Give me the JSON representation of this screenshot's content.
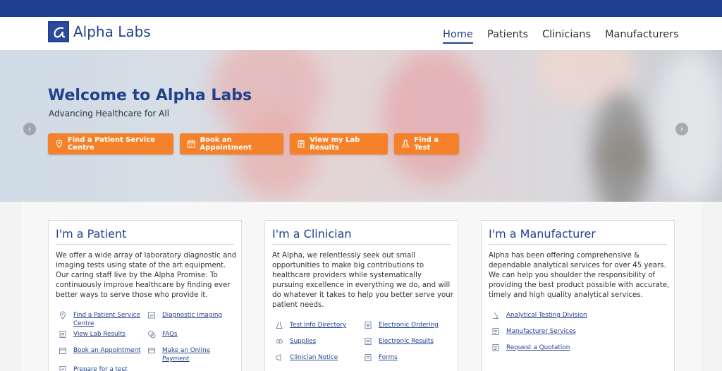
{
  "brand": {
    "name": "Alpha Labs"
  },
  "nav": {
    "home": "Home",
    "patients": "Patients",
    "clinicians": "Clinicians",
    "manufacturers": "Manufacturers"
  },
  "hero": {
    "title": "Welcome to Alpha Labs",
    "subtitle": "Advancing Healthcare for All",
    "buttons": [
      "Find a Patient Service Centre",
      "Book an Appointment",
      "View my Lab Results",
      "Find a Test"
    ]
  },
  "cards": {
    "patient": {
      "title": "I'm a Patient",
      "text": "We offer a wide array of laboratory diagnostic and imaging tests using state of the art equipment. Our caring staff live by the Alpha Promise: To continuously improve healthcare by finding ever better ways to serve those who provide it.",
      "links": [
        "Find a Patient Service Centre",
        "Diagnostic Imaging",
        "View Lab Results",
        "FAQs",
        "Book an Appointment",
        "Make an Online Payment",
        "Prepare for a test"
      ]
    },
    "clinician": {
      "title": "I'm a Clinician",
      "text": "At Alpha, we relentlessly seek out small opportunities to make big contributions to healthcare providers while systematically pursuing excellence in everything we do, and will do whatever it takes to help you better serve your patient needs.",
      "links": [
        "Test Info Directory",
        "Electronic Ordering",
        "Supplies",
        "Electronic Results",
        "Clinician Notice",
        "Forms"
      ]
    },
    "manufacturer": {
      "title": "I'm a Manufacturer",
      "text": "Alpha has been offering comprehensive & dependable analytical services for over 45 years. We can help you shoulder the responsibility of providing the best product possible with accurate, timely and high quality analytical services.",
      "links": [
        "Analytical Testing Division",
        "Manufacturer Services",
        "Request a Quotation"
      ]
    }
  },
  "colors": {
    "brand": "#23428e",
    "topbar": "#1f3f8f",
    "accent": "#f5822a"
  }
}
